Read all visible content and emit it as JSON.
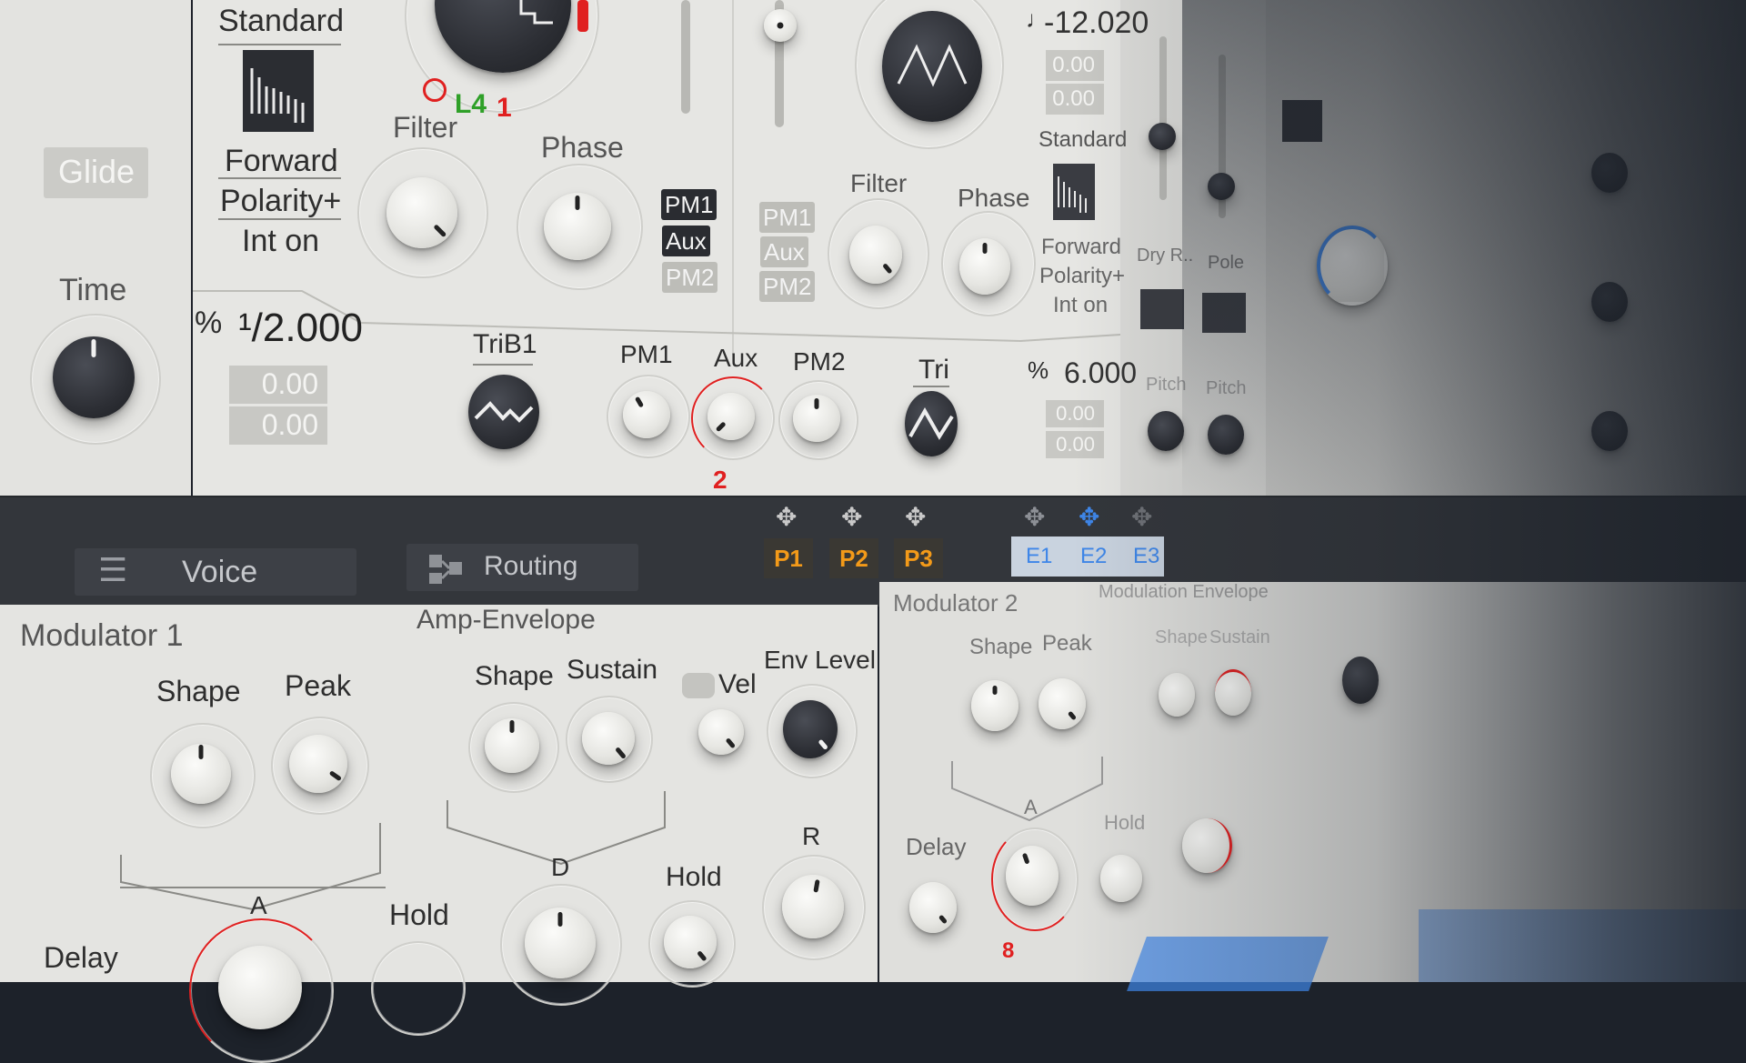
{
  "left_panel": {
    "glide_label": "Glide",
    "time_label": "Time"
  },
  "osc1": {
    "mode_standard": "Standard",
    "mode_forward": "Forward",
    "mode_polarity": "Polarity+",
    "mode_int": "Int on",
    "lfo_label": "L4",
    "lfo_number": "1",
    "filter_label": "Filter",
    "phase_label": "Phase",
    "pm_tags": [
      "PM1",
      "Aux",
      "PM2"
    ],
    "ratio_icon": "%",
    "ratio_value": "¹/2.000",
    "value_a": "0.00",
    "value_b": "0.00",
    "wave_name": "TriB1",
    "pm1_label": "PM1",
    "aux_label": "Aux",
    "pm2_label": "PM2",
    "aux_mod_amount": "2",
    "tri_label": "Tri"
  },
  "osc2": {
    "tune_value": "-12.020",
    "value_a": "0.00",
    "value_b": "0.00",
    "mode_standard": "Standard",
    "mode_forward": "Forward",
    "mode_polarity": "Polarity+",
    "mode_int": "Int on",
    "filter_label": "Filter",
    "phase_label": "Phase",
    "pm_tags": [
      "PM1",
      "Aux",
      "PM2"
    ],
    "ratio_icon": "%",
    "ratio_value": "6.000",
    "value_c": "0.00",
    "value_d": "0.00"
  },
  "far_right": {
    "dry_label": "Dry R..",
    "pole_label": "Pole",
    "pitch1_label": "Pitch",
    "pitch2_label": "Pitch"
  },
  "toolbar": {
    "voice_tab": "Voice",
    "routing_tab": "Routing",
    "p_tags": [
      "P1",
      "P2",
      "P3"
    ],
    "e_tags": [
      "E1",
      "E2",
      "E3"
    ]
  },
  "modulator1": {
    "title": "Modulator 1",
    "shape_label": "Shape",
    "peak_label": "Peak",
    "a_label": "A",
    "delay_label": "Delay",
    "hold_label": "Hold"
  },
  "amp_env": {
    "title": "Amp-Envelope",
    "shape_label": "Shape",
    "sustain_label": "Sustain",
    "vel_label": "Vel",
    "env_level_label": "Env Level",
    "d_label": "D",
    "hold_label": "Hold",
    "r_label": "R"
  },
  "modulator2": {
    "title": "Modulator 2",
    "shape_label": "Shape",
    "peak_label": "Peak",
    "a_label": "A",
    "delay_label": "Delay",
    "hold_label": "Hold",
    "mod_amount": "8"
  },
  "mod_env": {
    "title": "Modulation Envelope",
    "shape_label": "Shape",
    "sustain_label": "Sustain"
  },
  "colors": {
    "panel": "#e6e6e3",
    "toolbar": "#33363b",
    "accent_orange": "#f39a19",
    "accent_red": "#e02020",
    "accent_blue": "#3e86e8",
    "lfo_green": "#2fa028"
  }
}
